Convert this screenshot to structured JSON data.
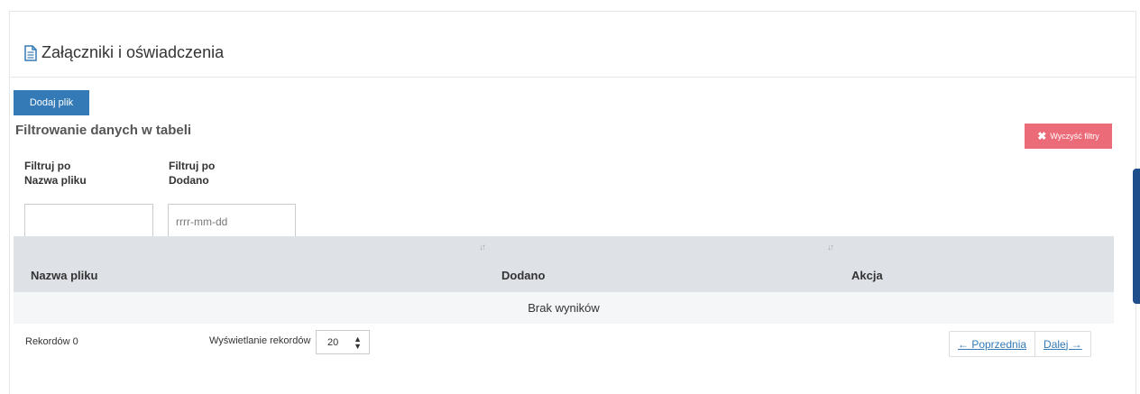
{
  "panel": {
    "title": "Załączniki i oświadczenia",
    "icon": "document-icon"
  },
  "actions": {
    "add_file": "Dodaj plik",
    "clear_filters": "Wyczyść filtry",
    "clear_filters_icon": "close-icon"
  },
  "filters": {
    "heading": "Filtrowanie danych w tabeli",
    "items": [
      {
        "label_line1": "Filtruj po",
        "label_line2": "Nazwa pliku",
        "value": "",
        "placeholder": ""
      },
      {
        "label_line1": "Filtruj po",
        "label_line2": "Dodano",
        "value": "",
        "placeholder": "rrrr-mm-dd"
      }
    ]
  },
  "table": {
    "columns": [
      "Nazwa pliku",
      "Dodano",
      "Akcja"
    ],
    "sort_icon": "sort-icon",
    "empty_message": "Brak wyników",
    "header_bg": "#dee2e6"
  },
  "footer": {
    "records": "Rekordów 0",
    "per_page_label": "Wyświetlanie rekordów",
    "per_page_value": "20",
    "prev": "← Poprzednia",
    "next": "Dalej →"
  },
  "colors": {
    "primary": "#337ab7",
    "danger": "#ec6b78",
    "side_widget": "#1f4e8c"
  }
}
